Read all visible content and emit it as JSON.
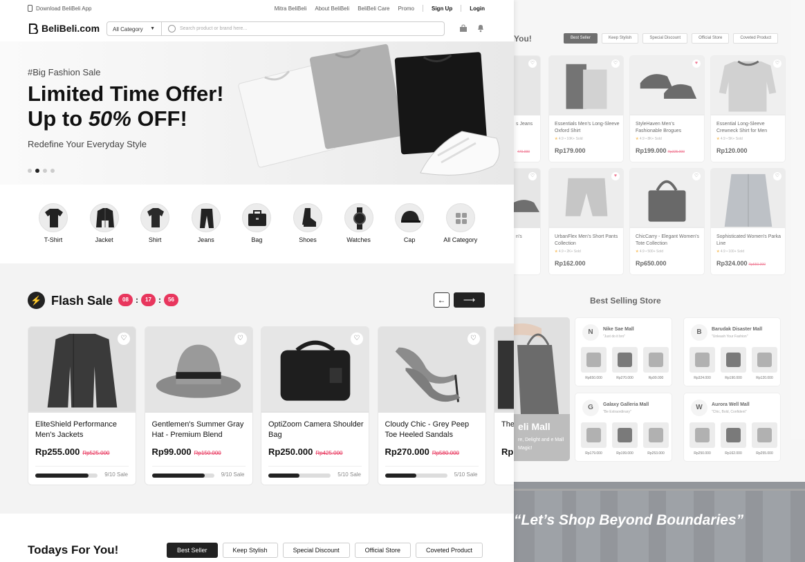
{
  "topbar": {
    "download": "Download BeliBeli App",
    "links": [
      "Mitra BeliBeli",
      "About BeliBeli",
      "BeliBeli Care",
      "Promo"
    ],
    "signup": "Sign Up",
    "login": "Login"
  },
  "header": {
    "logo": "BeliBeli.com",
    "category": "All Category",
    "search_placeholder": "Search product or brand here..."
  },
  "hero": {
    "tag": "#Big Fashion Sale",
    "line1": "Limited Time Offer!",
    "line2_pre": "Up to ",
    "line2_em": "50%",
    "line2_post": " OFF!",
    "sub": "Redefine Your Everyday Style"
  },
  "categories": [
    "T-Shirt",
    "Jacket",
    "Shirt",
    "Jeans",
    "Bag",
    "Shoes",
    "Watches",
    "Cap",
    "All Category"
  ],
  "flash": {
    "title": "Flash Sale",
    "timer": [
      "08",
      "17",
      "56"
    ],
    "products": [
      {
        "name": "EliteShield Performance Men's Jackets",
        "price": "Rp255.000",
        "old": "Rp525.000",
        "sold": "9/10 Sale",
        "pct": 0.85
      },
      {
        "name": "Gentlemen's Summer Gray Hat - Premium Blend",
        "price": "Rp99.000",
        "old": "Rp150.000",
        "sold": "9/10 Sale",
        "pct": 0.85
      },
      {
        "name": "OptiZoom Camera Shoulder Bag",
        "price": "Rp250.000",
        "old": "Rp425.000",
        "sold": "5/10 Sale",
        "pct": 0.5
      },
      {
        "name": "Cloudy Chic - Grey Peep Toe Heeled Sandals",
        "price": "Rp270.000",
        "old": "Rp580.000",
        "sold": "5/10 Sale",
        "pct": 0.5
      },
      {
        "name": "The... Pre...",
        "price": "Rp...",
        "old": "",
        "sold": "",
        "pct": 0
      }
    ]
  },
  "today": {
    "title": "Todays For You!",
    "tabs": [
      "Best Seller",
      "Keep Stylish",
      "Special Discount",
      "Official Store",
      "Coveted Product"
    ]
  },
  "right": {
    "title_tail": "You!",
    "tabs": [
      "Best Seller",
      "Keep Stylish",
      "Special Discount",
      "Official Store",
      "Coveted Product"
    ],
    "products": [
      {
        "name": "Essentials Men's Long-Sleeve Oxford Shirt",
        "rating": "4.9",
        "sold": "10K+ Sold",
        "price": "Rp179.000",
        "old": "",
        "heart": "off"
      },
      {
        "name": "StyleHaven Men's Fashionable Brogues",
        "rating": "4.9",
        "sold": "8K+ Sold",
        "price": "Rp199.000",
        "old": "Rp325.000",
        "heart": "on"
      },
      {
        "name": "Essential Long-Sleeve Crewneck Shirt for Men",
        "rating": "4.9",
        "sold": "5K+ Sold",
        "price": "Rp120.000",
        "old": "",
        "heart": "off"
      },
      {
        "name": "UrbanFlex Men's Short Pants Collection",
        "rating": "4.9",
        "sold": "2K+ Sold",
        "price": "Rp162.000",
        "old": "",
        "heart": "on"
      },
      {
        "name": "ChicCarry - Elegant Women's Tote Collection",
        "rating": "4.9",
        "sold": "500+ Sold",
        "price": "Rp650.000",
        "old": "",
        "heart": "off"
      },
      {
        "name": "Sophisticated Women's Parka Line",
        "rating": "4.9",
        "sold": "100+ Sold",
        "price": "Rp324.000",
        "old": "Rp550.000",
        "heart": "off"
      }
    ],
    "partial": {
      "t1": "s Jeans",
      "p1": "470.000",
      "t2": "n's"
    },
    "stores_title": "Best Selling Store",
    "stores": [
      {
        "name": "Nike Sae Mall",
        "slogan": "\"Just do it bro\"",
        "prices": [
          "Rp650.000",
          "Rp270.000",
          "Rp99.000"
        ]
      },
      {
        "name": "Barudak Disaster Mall",
        "slogan": "\"Unleash Your Fashion\"",
        "prices": [
          "Rp324.000",
          "Rp190.000",
          "Rp120.000"
        ]
      },
      {
        "name": "Galaxy Galleria Mall",
        "slogan": "\"Be Extraordinary\"",
        "prices": [
          "Rp179.000",
          "Rp199.000",
          "Rp253.000"
        ]
      },
      {
        "name": "Aurora Well Mall",
        "slogan": "\"Chic, Bold, Confident\"",
        "prices": [
          "Rp250.000",
          "Rp162.000",
          "Rp255.000"
        ]
      }
    ],
    "promo_title": "eli Mall",
    "promo_sub": "re, Delight and e Mall Magic!",
    "quote": "“Let’s Shop Beyond Boundaries”"
  },
  "colors": {
    "accent": "#e8365d",
    "dark": "#222222"
  }
}
